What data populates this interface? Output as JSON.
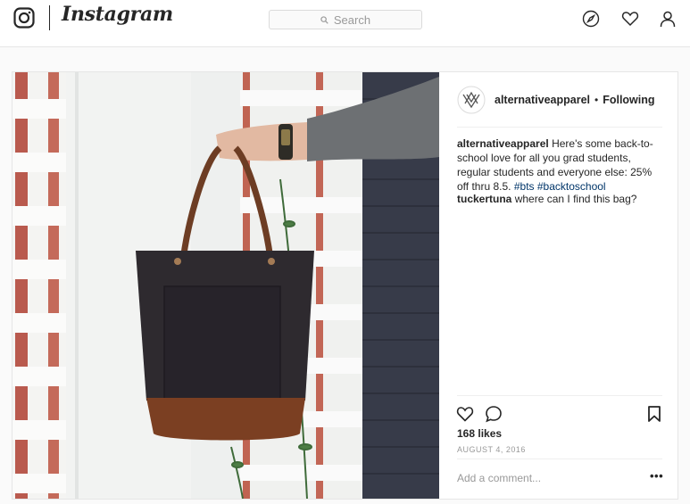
{
  "header": {
    "wordmark": "Instagram",
    "search_placeholder": "Search",
    "icons": [
      "instagram-logo-icon",
      "search-icon",
      "compass-icon",
      "heart-icon",
      "profile-icon"
    ]
  },
  "post": {
    "author": "alternativeapparel",
    "separator": "•",
    "follow_status": "Following",
    "caption_user": "alternativeapparel",
    "caption_text": "Here's some back-to-school love for all you grad students, regular students and everyone else: 25% off thru 8.5.",
    "hashtags": [
      "#bts",
      "#backtoschool"
    ],
    "comments": [
      {
        "user": "tuckertuna",
        "text": "where can I find this bag?"
      }
    ],
    "likes": "168 likes",
    "date": "AUGUST 4, 2016",
    "add_comment_placeholder": "Add a comment...",
    "more_label": "•••",
    "action_icons": [
      "heart-icon",
      "comment-icon",
      "bookmark-icon"
    ]
  },
  "colors": {
    "text": "#262626",
    "muted": "#999999",
    "hashtag": "#003569",
    "border": "#e6e6e6",
    "background": "#fafafa"
  }
}
